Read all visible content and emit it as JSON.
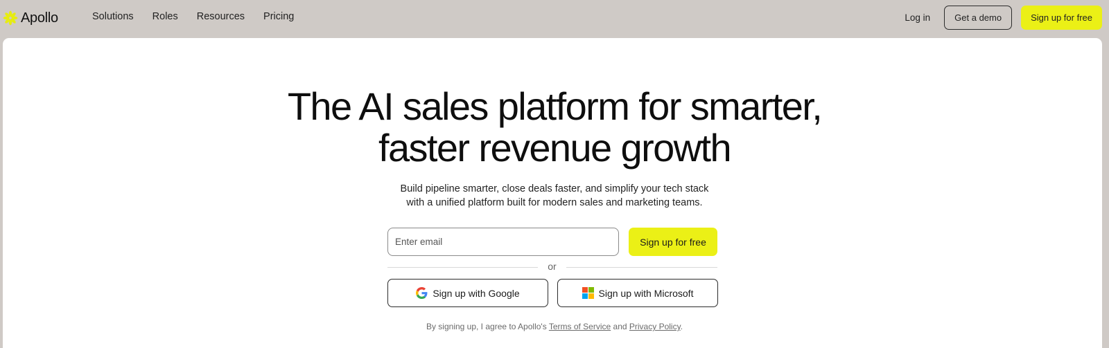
{
  "brand": {
    "name": "Apollo",
    "logo_icon": "asterisk-flower-icon",
    "accent_color": "#ebf016"
  },
  "nav": {
    "links": [
      "Solutions",
      "Roles",
      "Resources",
      "Pricing"
    ],
    "login": "Log in",
    "demo_button": "Get a demo",
    "signup_button": "Sign up for free"
  },
  "hero": {
    "headline_line1": "The AI sales platform for smarter,",
    "headline_line2": "faster revenue growth",
    "subtext_line1": "Build pipeline smarter, close deals faster, and simplify your tech stack",
    "subtext_line2": "with a unified platform built for modern sales and marketing teams."
  },
  "signup_form": {
    "email_placeholder": "Enter email",
    "email_value": "",
    "submit_label": "Sign up for free",
    "divider_text": "or",
    "google_label": "Sign up with Google",
    "google_icon": "google-g-icon",
    "microsoft_label": "Sign up with Microsoft",
    "microsoft_icon": "microsoft-logo-icon"
  },
  "legal": {
    "prefix": "By signing up, I agree to Apollo's ",
    "terms_link": "Terms of Service",
    "middle": " and ",
    "privacy_link": "Privacy Policy",
    "suffix": "."
  }
}
